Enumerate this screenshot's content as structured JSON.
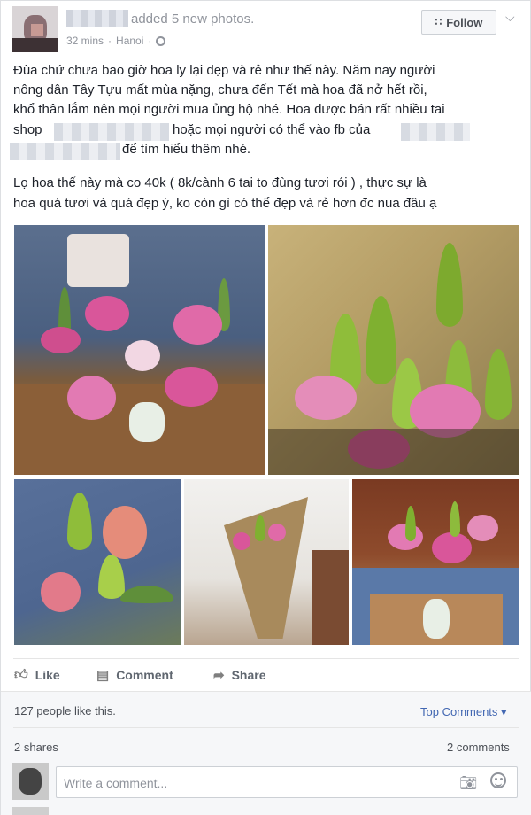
{
  "post": {
    "headline": "added 5 new photos.",
    "time": "32 mins",
    "location": "Hanoi",
    "separator": "·",
    "follow_label": "Follow",
    "paragraph1_line1": "Đùa chứ chưa bao giờ hoa ly lại đẹp và rẻ như thế này. Năm nay người",
    "paragraph1_line2": "nông dân Tây Tựu mất mùa nặng, chưa đến Tết mà hoa đã nở hết rồi,",
    "paragraph1_line3": "khổ thân lắm nên mọi người mua ủng hộ nhé. Hoa được bán rất nhiều tai",
    "paragraph1_line4a": "shop",
    "paragraph1_line4b": "hoặc mọi người có thể vào fb của",
    "paragraph1_line5": "để tìm hiểu thêm nhé.",
    "paragraph2_line1": "Lọ hoa thế này mà co 40k ( 8k/cành 6 tai to đùng tươi rói ) , thực sự là",
    "paragraph2_line2": "hoa quá tươi và quá đẹp ý, ko còn gì có thể đẹp và rẻ hơn đc nua đâu ạ"
  },
  "actions": {
    "like": "Like",
    "comment": "Comment",
    "share": "Share"
  },
  "stats": {
    "likes": "127 people like this.",
    "top_comments": "Top Comments ▾",
    "shares": "2 shares",
    "comments": "2 comments"
  },
  "composer": {
    "placeholder": "Write a comment..."
  },
  "colors": {
    "link": "#4267b2",
    "muted": "#90949c",
    "border": "#dddfe2"
  }
}
